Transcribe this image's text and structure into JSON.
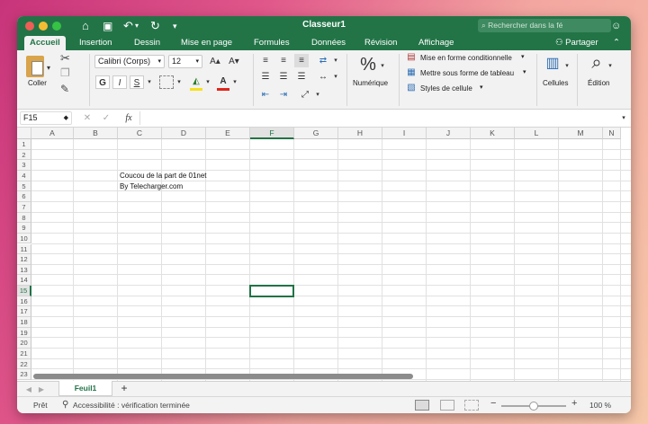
{
  "window": {
    "title": "Classeur1"
  },
  "colors": {
    "brand": "#227447",
    "selection": "#217346"
  },
  "quick_access": {
    "icons": [
      "home-icon",
      "save-icon",
      "undo-icon",
      "redo-icon",
      "more-icon"
    ]
  },
  "search": {
    "placeholder": "Rechercher dans la fé"
  },
  "tabs": [
    {
      "label": "Accueil",
      "active": true
    },
    {
      "label": "Insertion"
    },
    {
      "label": "Dessin"
    },
    {
      "label": "Mise en page"
    },
    {
      "label": "Formules"
    },
    {
      "label": "Données"
    },
    {
      "label": "Révision"
    },
    {
      "label": "Affichage"
    }
  ],
  "share": {
    "label": "Partager"
  },
  "ribbon": {
    "paste_label": "Coller",
    "font_name": "Calibri (Corps)",
    "font_size": "12",
    "grow_font": "A▴",
    "shrink_font": "A▾",
    "bold": "G",
    "italic": "I",
    "underline": "S",
    "number_symbol": "%",
    "number_label": "Numérique",
    "conditional_formatting": "Mise en forme conditionnelle",
    "format_as_table": "Mettre sous forme de tableau",
    "cell_styles": "Styles de cellule",
    "cells_label": "Cellules",
    "editing_label": "Édition"
  },
  "formula_bar": {
    "name_box": "F15",
    "fx": "fx",
    "value": ""
  },
  "columns": [
    "A",
    "B",
    "C",
    "D",
    "E",
    "F",
    "G",
    "H",
    "I",
    "J",
    "K",
    "L",
    "M",
    "N"
  ],
  "rows": [
    "1",
    "2",
    "3",
    "4",
    "5",
    "6",
    "7",
    "8",
    "9",
    "10",
    "11",
    "12",
    "13",
    "14",
    "15",
    "16",
    "17",
    "18",
    "19",
    "20",
    "21",
    "22",
    "23"
  ],
  "cells": {
    "C4": "Coucou de la part de 01net",
    "C5": "By Telecharger.com"
  },
  "selected_cell": "F15",
  "sheets": [
    {
      "name": "Feuil1",
      "active": true
    }
  ],
  "add_sheet": "+",
  "status": {
    "ready": "Prêt",
    "accessibility": "Accessibilité : vérification terminée",
    "zoom": "100 %",
    "zoom_fraction": 0.5
  }
}
